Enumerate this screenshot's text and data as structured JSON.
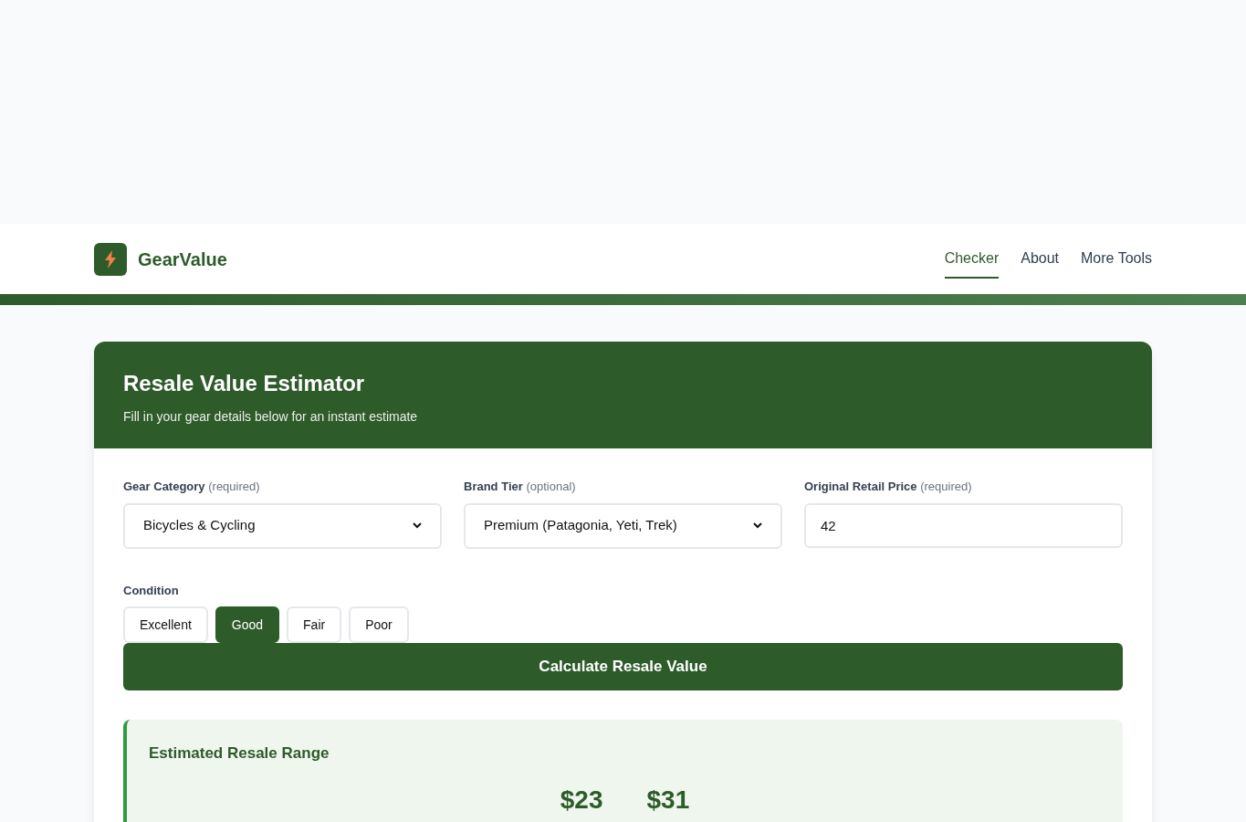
{
  "brand": {
    "name": "GearValue"
  },
  "nav": [
    {
      "label": "Checker",
      "selected": true
    },
    {
      "label": "About",
      "selected": false
    },
    {
      "label": "More Tools",
      "selected": false
    }
  ],
  "card": {
    "title": "Resale Value Estimator",
    "subtitle": "Fill in your gear details below for an instant estimate"
  },
  "fields": [
    {
      "kind": "select",
      "label": "Gear Category",
      "hint": "(required)",
      "value": "Bicycles & Cycling"
    },
    {
      "kind": "select",
      "label": "Brand Tier",
      "hint": "(optional)",
      "value": "Premium (Patagonia, Yeti, Trek)"
    },
    {
      "kind": "input",
      "label": "Original Retail Price",
      "hint": "(required)",
      "value": "42"
    }
  ],
  "condition": {
    "label": "Condition",
    "options": [
      {
        "label": "Excellent",
        "selected": false
      },
      {
        "label": "Good",
        "selected": true
      },
      {
        "label": "Fair",
        "selected": false
      },
      {
        "label": "Poor",
        "selected": false
      }
    ]
  },
  "submit": "Calculate Resale Value",
  "result": {
    "title": "Estimated Resale Range",
    "low": "$23",
    "high": "$31"
  }
}
